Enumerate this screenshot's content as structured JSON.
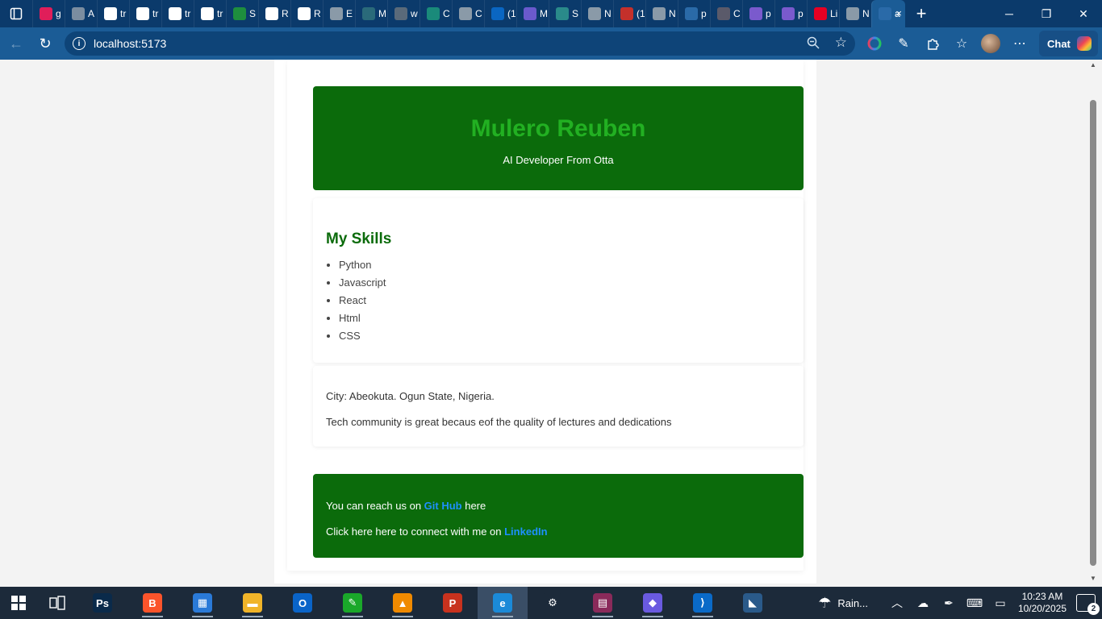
{
  "browser": {
    "tabs": [
      {
        "title": "g",
        "color": "#e01e5a"
      },
      {
        "title": "A",
        "color": "#7b8da0"
      },
      {
        "title": "tr",
        "color": "#ffffff"
      },
      {
        "title": "tr",
        "color": "#ffffff"
      },
      {
        "title": "tr",
        "color": "#ffffff"
      },
      {
        "title": "tr",
        "color": "#ffffff"
      },
      {
        "title": "S",
        "color": "#1e8e3e"
      },
      {
        "title": "R",
        "color": "#ffffff"
      },
      {
        "title": "R",
        "color": "#ffffff"
      },
      {
        "title": "E",
        "color": "#8a9aa8"
      },
      {
        "title": "M",
        "color": "#2a6a7a"
      },
      {
        "title": "w",
        "color": "#5a6a7a"
      },
      {
        "title": "C",
        "color": "#1a8a7a"
      },
      {
        "title": "C",
        "color": "#8a9aa8"
      },
      {
        "title": "(1",
        "color": "#0a66c2"
      },
      {
        "title": "M",
        "color": "#6a5acd"
      },
      {
        "title": "S",
        "color": "#2a8a8a"
      },
      {
        "title": "N",
        "color": "#8a9aa8"
      },
      {
        "title": "(1",
        "color": "#c4302b"
      },
      {
        "title": "N",
        "color": "#8a9aa8"
      },
      {
        "title": "p",
        "color": "#2a6aa8"
      },
      {
        "title": "C",
        "color": "#5a5a6a"
      },
      {
        "title": "p",
        "color": "#7a5acd"
      },
      {
        "title": "p",
        "color": "#7a5acd"
      },
      {
        "title": "Li",
        "color": "#e60023"
      },
      {
        "title": "N",
        "color": "#8a9aa8"
      }
    ],
    "active_tab": {
      "title": "a",
      "close": "×"
    },
    "new_tab": "+",
    "window": {
      "minimize": "─",
      "maximize": "❐",
      "close": "✕"
    },
    "address": "localhost:5173",
    "info_icon": "i",
    "back": "←",
    "refresh": "↻",
    "chat_label": "Chat"
  },
  "page": {
    "hero": {
      "name": "Mulero Reuben",
      "tagline": "AI Developer From Otta"
    },
    "skills": {
      "heading": "My Skills",
      "items": [
        "Python",
        "Javascript",
        "React",
        "Html",
        "CSS"
      ]
    },
    "about": {
      "city": "City: Abeokuta. Ogun State, Nigeria.",
      "community": "Tech community is great becaus eof the quality of lectures and dedications"
    },
    "contact": {
      "line1_prefix": "You can reach us on ",
      "github_link": "Git Hub",
      "line1_suffix": " here",
      "line2_prefix": "Click here here to connect with me on ",
      "linkedin_link": "LinkedIn"
    }
  },
  "taskbar": {
    "apps": [
      {
        "name": "photoshop",
        "label": "Ps",
        "color": "#0a2a4a"
      },
      {
        "name": "brave",
        "label": "B",
        "color": "#fb542b"
      },
      {
        "name": "store",
        "label": "▦",
        "color": "#2a7ad8"
      },
      {
        "name": "explorer",
        "label": "▬",
        "color": "#f0b429"
      },
      {
        "name": "outlook",
        "label": "O",
        "color": "#0a64c8"
      },
      {
        "name": "notepad",
        "label": "✎",
        "color": "#1aa82a"
      },
      {
        "name": "vlc",
        "label": "▲",
        "color": "#f08a00"
      },
      {
        "name": "pp",
        "label": "P",
        "color": "#c8321e"
      },
      {
        "name": "edge",
        "label": "e",
        "color": "#1b8ad8"
      },
      {
        "name": "settings",
        "label": "⚙",
        "color": "#1c2a3a"
      },
      {
        "name": "winrar",
        "label": "▤",
        "color": "#8a2a5a"
      },
      {
        "name": "copilot",
        "label": "◆",
        "color": "#6a5ae0"
      },
      {
        "name": "vscode",
        "label": "⟩",
        "color": "#0a6ac8"
      },
      {
        "name": "other",
        "label": "◣",
        "color": "#2a5a8a"
      }
    ],
    "weather": "Rain...",
    "time": "10:23 AM",
    "date": "10/20/2025",
    "notifications": "2"
  }
}
